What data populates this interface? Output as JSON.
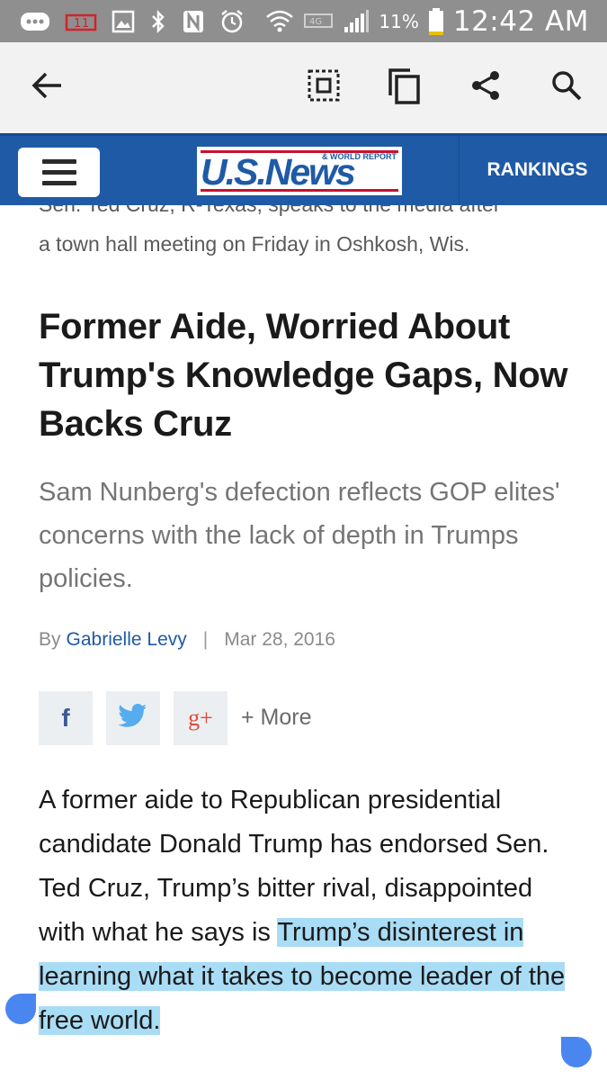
{
  "status_bar": {
    "battery_percent": "11%",
    "time": "12:42 AM",
    "icons": [
      "message-icon",
      "sim-icon",
      "gallery-icon",
      "bluetooth-icon",
      "nfc-icon",
      "alarm-icon",
      "wifi-icon",
      "data-icon",
      "signal-icon",
      "battery-icon"
    ]
  },
  "browser_toolbar": {
    "icons": [
      "back-arrow-icon",
      "select-icon",
      "copy-icon",
      "share-icon",
      "search-icon"
    ]
  },
  "site_header": {
    "logo_main": "U.S.News",
    "logo_sub": "& WORLD REPORT",
    "rankings_label": "RANKINGS",
    "brand_color": "#1f5aa6"
  },
  "article": {
    "caption_line1": "Sen. Ted Cruz, R-Texas, speaks to the media after",
    "caption_line2": "a town hall meeting on Friday in Oshkosh, Wis.",
    "headline": "Former Aide, Worried About Trump's Knowledge Gaps, Now Backs Cruz",
    "dek": "Sam Nunberg's defection reflects GOP elites' concerns with the lack of depth in Trumps policies.",
    "byline_prefix": "By",
    "author": "Gabrielle Levy",
    "separator": "|",
    "date": "Mar 28, 2016",
    "share": {
      "facebook": "f",
      "twitter": "twitter-icon",
      "google_plus": "g+",
      "more_label": "+ More"
    },
    "body_plain": "A former aide to Republican presidential candidate Donald Trump has endorsed Sen. Ted Cruz, Trump’s bitter rival, disappointed with what he says is ",
    "body_highlighted": "Trump’s disinterest in learning what it takes to become leader of the free world.",
    "highlight_color": "#a9dcf5"
  }
}
